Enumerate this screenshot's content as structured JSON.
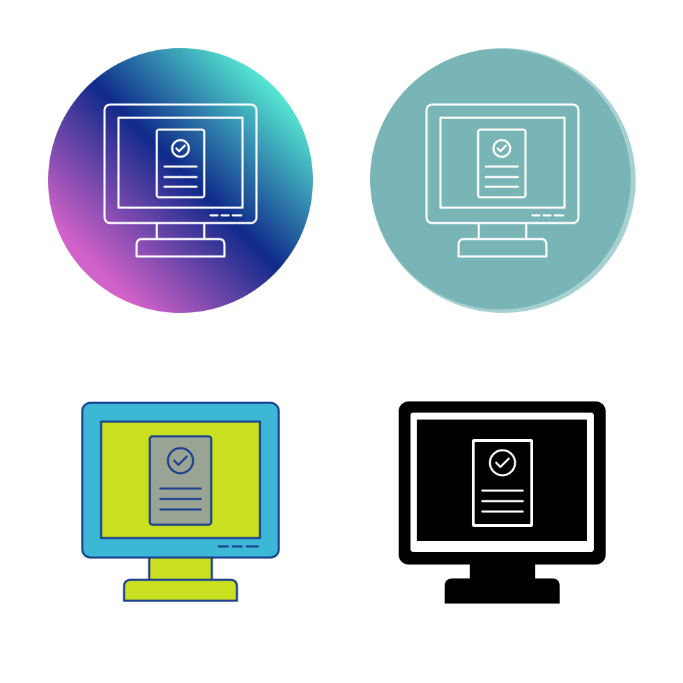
{
  "icon_set": {
    "subject": "monitor-with-approved-document-icon",
    "variants": [
      {
        "style": "gradient-circle-line",
        "colors": {
          "gradient_start": "#d062c9",
          "gradient_mid": "#0f2a8a",
          "gradient_end": "#5cf7d8",
          "stroke": "#ffffff"
        }
      },
      {
        "style": "flat-circle-line",
        "colors": {
          "circle": "#79b4b6",
          "circle_shade": "#a6d0d1",
          "stroke": "#ffffff"
        }
      },
      {
        "style": "filled-color",
        "colors": {
          "frame": "#3cb8d6",
          "screen": "#c8e01f",
          "document": "#9aa494",
          "stand": "#c8e01f",
          "outline": "#1c3f8f"
        }
      },
      {
        "style": "glyph",
        "colors": {
          "fill": "#000000",
          "inner": "#ffffff"
        }
      }
    ]
  }
}
